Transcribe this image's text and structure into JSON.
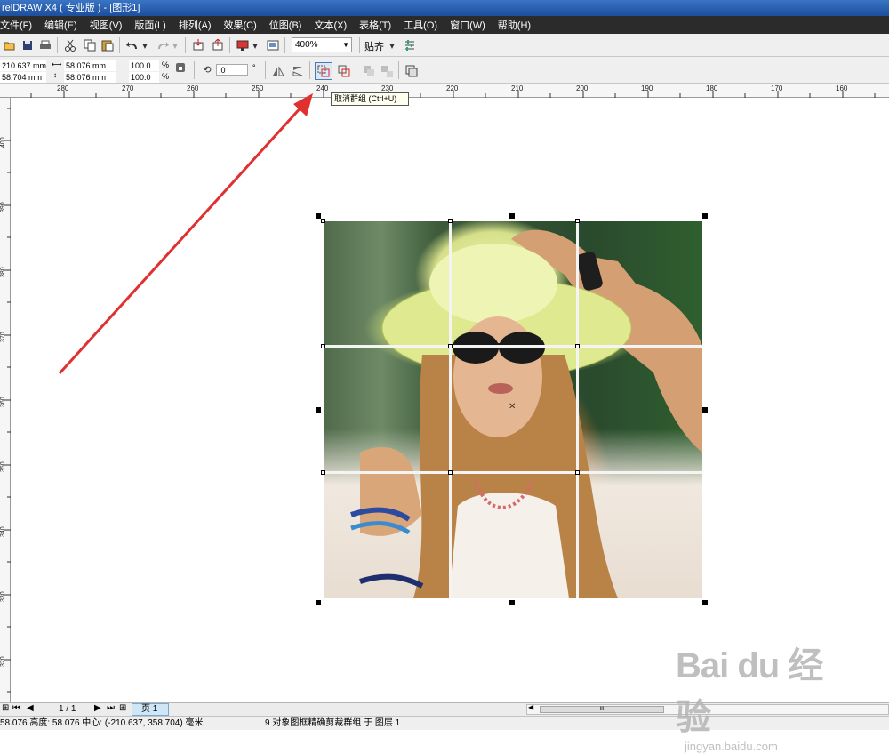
{
  "window": {
    "title": "relDRAW X4 ( 专业版 ) - [图形1]"
  },
  "menu": [
    "文件(F)",
    "编辑(E)",
    "视图(V)",
    "版面(L)",
    "排列(A)",
    "效果(C)",
    "位图(B)",
    "文本(X)",
    "表格(T)",
    "工具(O)",
    "窗口(W)",
    "帮助(H)"
  ],
  "toolbar": {
    "zoom_value": "400%",
    "snap_label": "贴齐"
  },
  "property_bar": {
    "pos_x": "210.637 mm",
    "pos_y": "58.704 mm",
    "width": "58.076 mm",
    "height": "58.076 mm",
    "scale_w": "100.0",
    "scale_h": "100.0",
    "pct1": "%",
    "pct2": "%",
    "rotation": ".0",
    "degree": "°"
  },
  "tooltip": "取消群组 (Ctrl+U)",
  "ruler_h": [
    "280",
    "270",
    "260",
    "250",
    "240",
    "230",
    "220",
    "210",
    "200",
    "190",
    "180",
    "170",
    "160"
  ],
  "ruler_v": [
    "400",
    "390",
    "380",
    "370",
    "360",
    "350",
    "340",
    "330",
    "320"
  ],
  "page_nav": {
    "counter": "1 / 1",
    "tab": "页 1",
    "scroll_grip": "III"
  },
  "status": {
    "text": "58.076  高度: 58.076  中心: (-210.637, 358.704)  毫米",
    "object_info": "9 对象图框精确剪裁群组 于 图层 1"
  },
  "watermark": {
    "brand": "Bai du 经验",
    "url": "jingyan.baidu.com"
  },
  "colors": {
    "titlebar": "#1c4f9c",
    "menubar": "#2b2b2b",
    "arrow": "#e03030"
  }
}
